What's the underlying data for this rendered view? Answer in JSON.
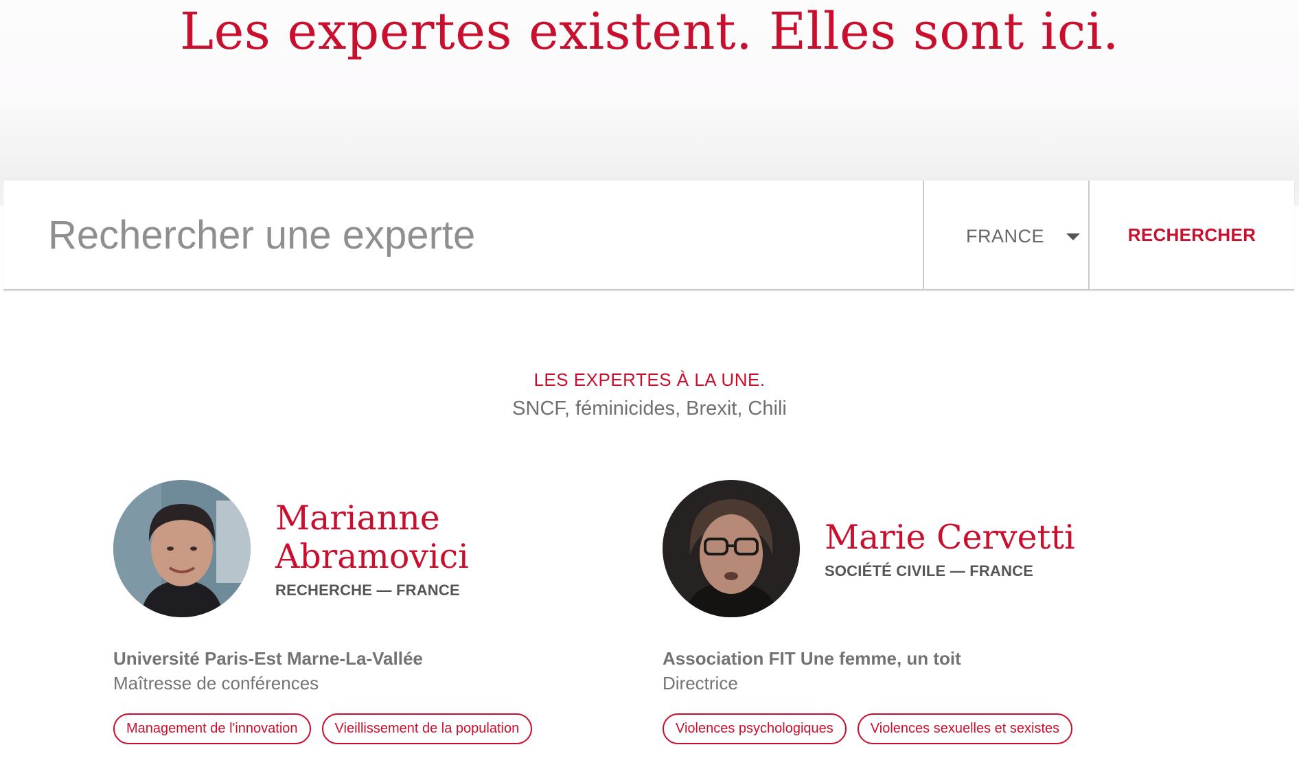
{
  "hero": {
    "title": "Les expertes existent. Elles sont ici."
  },
  "search": {
    "placeholder": "Rechercher une experte",
    "value": "",
    "country": "FRANCE",
    "button_label": "RECHERCHER"
  },
  "featured": {
    "heading": "LES EXPERTES À LA UNE.",
    "topics": "SNCF, féminicides, Brexit, Chili"
  },
  "experts": [
    {
      "name": "Marianne Abramovici",
      "meta": "RECHERCHE — FRANCE",
      "organization": "Université Paris-Est Marne-La-Vallée",
      "role": "Maîtresse de conférences",
      "tags": [
        "Management de l'innovation",
        "Vieillissement de la population"
      ]
    },
    {
      "name": "Marie Cervetti",
      "meta": "SOCIÉTÉ CIVILE — FRANCE",
      "organization": "Association FIT Une femme, un toit",
      "role": "Directrice",
      "tags": [
        "Violences psychologiques",
        "Violences sexuelles et sexistes"
      ]
    }
  ],
  "colors": {
    "accent": "#c8102e",
    "text_gray": "#737373",
    "border": "#c9c9c9"
  },
  "icons": {
    "country_dropdown": "chevron-down-icon"
  }
}
